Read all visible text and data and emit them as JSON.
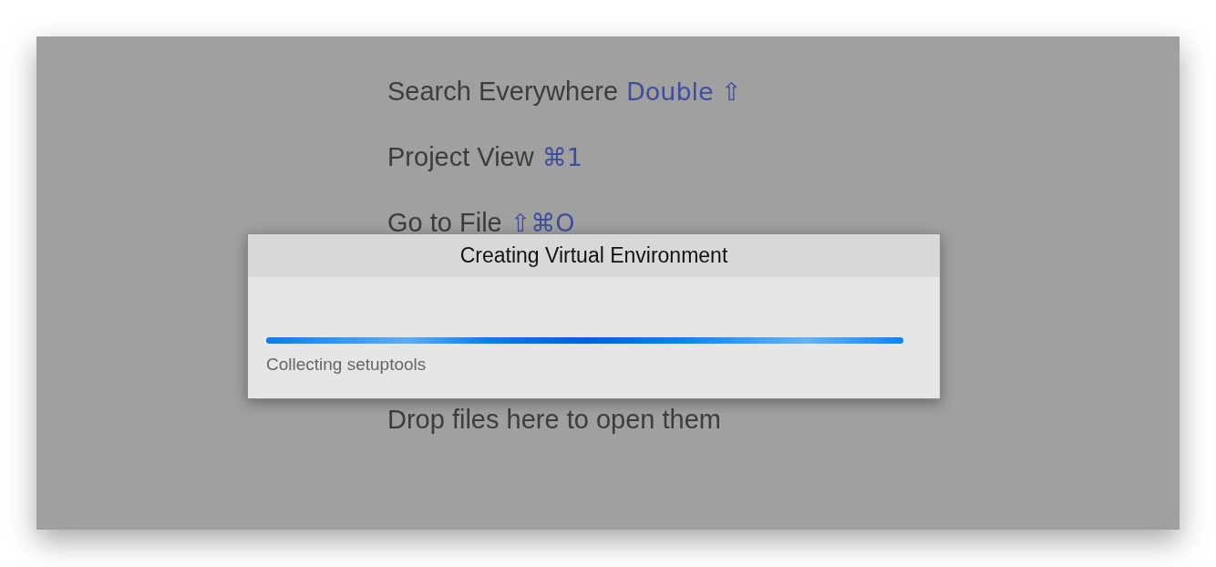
{
  "hints": [
    {
      "label": "Search Everywhere",
      "shortcut": "Double ⇧"
    },
    {
      "label": "Project View",
      "shortcut": "⌘1"
    },
    {
      "label": "Go to File",
      "shortcut": "⇧⌘O"
    },
    {
      "label": "Drop files here to open them"
    }
  ],
  "dialog": {
    "title": "Creating Virtual Environment",
    "status": "Collecting setuptools",
    "progress": {
      "level": 1
    }
  }
}
